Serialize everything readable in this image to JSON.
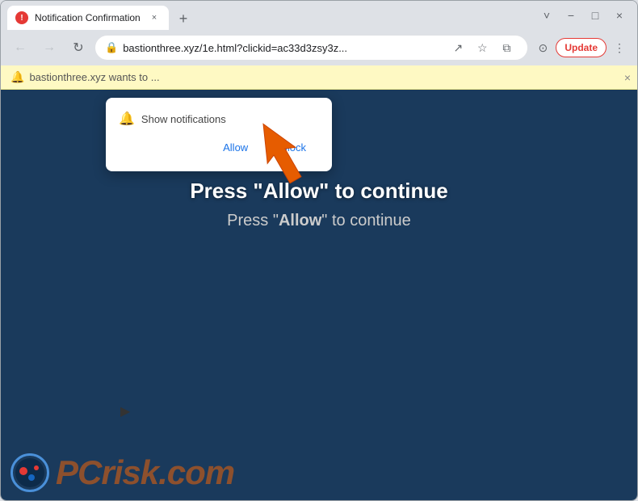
{
  "window": {
    "title": "Notification Confirmation",
    "favicon_label": "!",
    "tab_close_label": "×",
    "new_tab_label": "+"
  },
  "window_controls": {
    "minimize": "−",
    "maximize": "□",
    "close": "×",
    "chevron_down": "˅"
  },
  "nav": {
    "back_label": "←",
    "forward_label": "→",
    "reload_label": "↻",
    "url": "bastionthree.xyz/1e.html?clickid=ac33d3zsy3z...",
    "share_label": "↗",
    "bookmark_label": "☆",
    "extensions_label": "⧉",
    "profile_label": "⊙",
    "update_label": "Update",
    "more_label": "⋮"
  },
  "notification_bar": {
    "text": "bastionthree.xyz wants to ...",
    "close_label": "×"
  },
  "notification_popup": {
    "bell_icon": "🔔",
    "site_text": "Show notifications",
    "allow_label": "Allow",
    "block_label": "Block"
  },
  "page": {
    "main_text": "Press \"Allow\" to continue",
    "sub_text_prefix": "Press \"",
    "sub_text_bold": "Allow",
    "sub_text_suffix": "\" to continue"
  },
  "pcrisk": {
    "pc_text": "PC",
    "risk_text": "risk.com"
  },
  "colors": {
    "accent": "#1a73e8",
    "danger": "#e53935",
    "page_bg": "#1a3a5c",
    "notif_bar_bg": "#fef9c3",
    "tab_bg": "#ffffff",
    "chrome_bg": "#dee1e6"
  }
}
